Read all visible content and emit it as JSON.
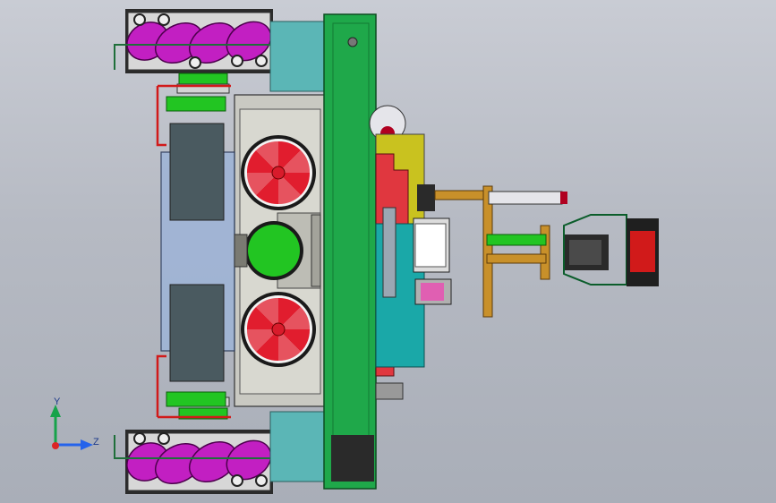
{
  "axis_triad": {
    "y_label": "Y",
    "z_label": "Z"
  },
  "colors": {
    "background_top": "#c9ccd4",
    "background_bottom": "#a9aeb8",
    "frame_green": "#1fa84a",
    "wheel_roller_magenta": "#c21fc2",
    "fan_red": "#e11d2e",
    "motor_green": "#22c522",
    "teal_panel": "#5bb6b6",
    "yellow_bracket": "#c9c21f",
    "bronze": "#c8902a",
    "chassis_grey": "#c9c9c2"
  }
}
